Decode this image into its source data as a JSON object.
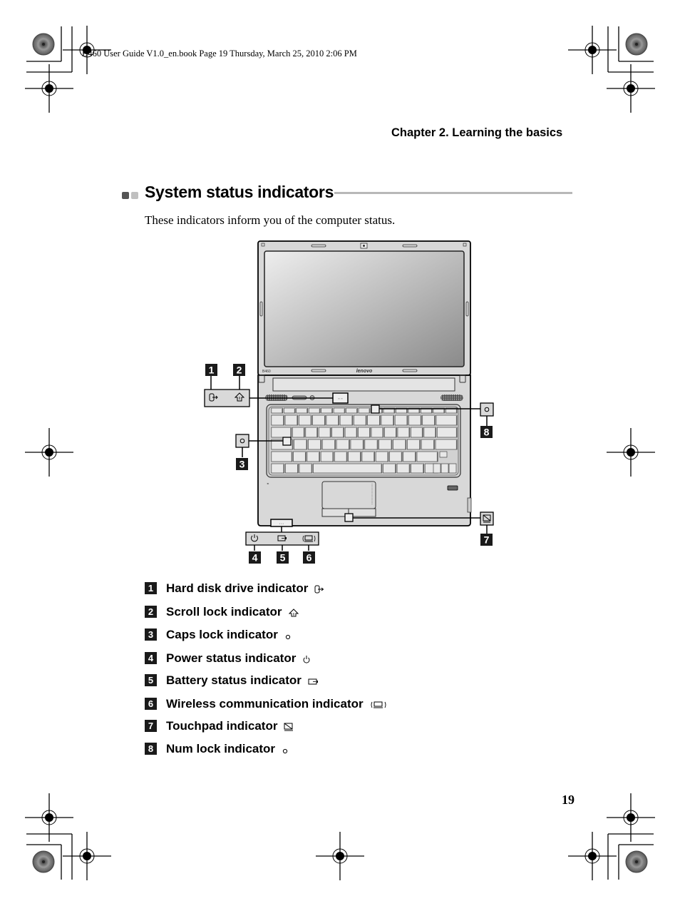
{
  "print_header": "B460 User Guide V1.0_en.book  Page 19  Thursday, March 25, 2010  2:06 PM",
  "running_head": "Chapter 2. Learning the basics",
  "section": {
    "title": "System status indicators",
    "intro": "These indicators inform you of the computer status."
  },
  "diagram": {
    "brand_logo": "lenovo",
    "model_label": "B460",
    "callouts": [
      {
        "number": "1",
        "icon": "hard-disk-icon"
      },
      {
        "number": "2",
        "icon": "scroll-lock-icon"
      },
      {
        "number": "3",
        "icon": "caps-lock-icon"
      },
      {
        "number": "4",
        "icon": "power-icon"
      },
      {
        "number": "5",
        "icon": "battery-icon"
      },
      {
        "number": "6",
        "icon": "wireless-icon"
      },
      {
        "number": "7",
        "icon": "touchpad-icon"
      },
      {
        "number": "8",
        "icon": "num-lock-icon"
      }
    ]
  },
  "legend": [
    {
      "number": "1",
      "label": "Hard disk drive indicator",
      "icon": "hard-disk-icon"
    },
    {
      "number": "2",
      "label": "Scroll lock indicator",
      "icon": "scroll-lock-icon"
    },
    {
      "number": "3",
      "label": "Caps lock indicator",
      "icon": "caps-lock-icon"
    },
    {
      "number": "4",
      "label": "Power status indicator",
      "icon": "power-icon"
    },
    {
      "number": "5",
      "label": "Battery status indicator",
      "icon": "battery-icon"
    },
    {
      "number": "6",
      "label": "Wireless communication indicator",
      "icon": "wireless-icon"
    },
    {
      "number": "7",
      "label": "Touchpad indicator",
      "icon": "touchpad-icon"
    },
    {
      "number": "8",
      "label": "Num lock indicator",
      "icon": "num-lock-icon"
    }
  ],
  "page_number": "19",
  "colors": {
    "badge": "#1a1a1a",
    "rule": "#b8b8b8",
    "bullet_dark": "#555555",
    "bullet_light": "#c0c0c0",
    "callout_box": "#d9d9d9"
  }
}
